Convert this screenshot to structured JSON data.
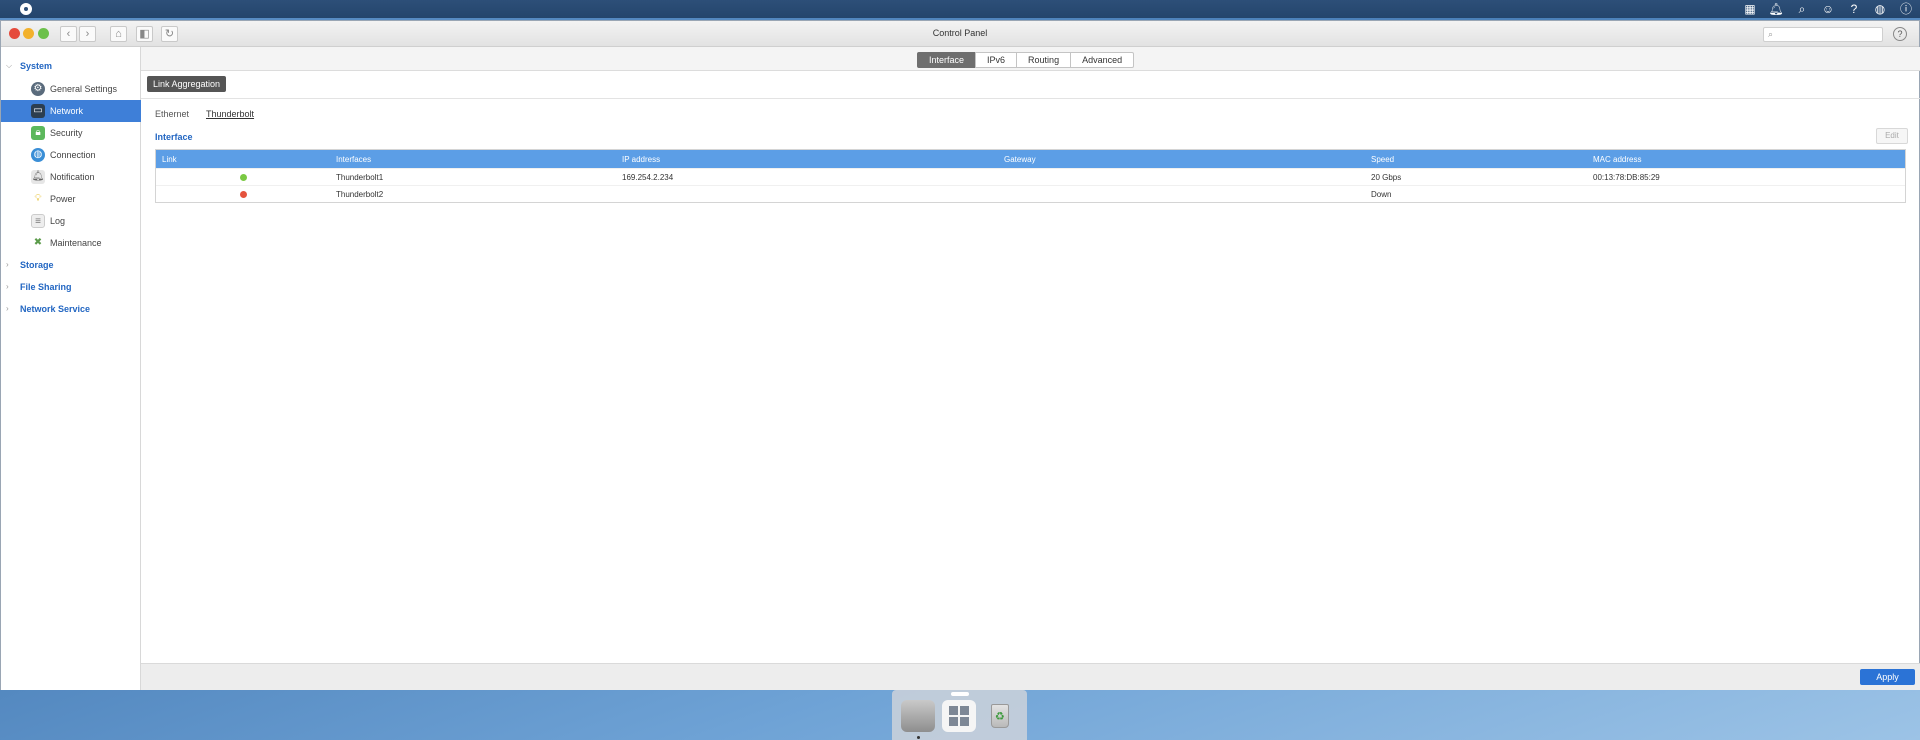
{
  "window": {
    "title": "Control Panel"
  },
  "top_icons": [
    "apps-icon",
    "bell-icon",
    "search-icon",
    "user-icon",
    "help-icon",
    "globe-icon",
    "info-icon"
  ],
  "sidebar": {
    "groups": [
      {
        "label": "System",
        "expanded": true
      },
      {
        "label": "Storage",
        "expanded": false
      },
      {
        "label": "File Sharing",
        "expanded": false
      },
      {
        "label": "Network Service",
        "expanded": false
      }
    ],
    "items": [
      {
        "label": "General Settings",
        "icon": "gear-icon"
      },
      {
        "label": "Network",
        "icon": "network-icon",
        "active": true
      },
      {
        "label": "Security",
        "icon": "lock-icon"
      },
      {
        "label": "Connection",
        "icon": "globe-icon"
      },
      {
        "label": "Notification",
        "icon": "bell-icon"
      },
      {
        "label": "Power",
        "icon": "lightbulb-icon"
      },
      {
        "label": "Log",
        "icon": "document-icon"
      },
      {
        "label": "Maintenance",
        "icon": "tools-icon"
      }
    ]
  },
  "tabs": [
    {
      "label": "Interface",
      "active": true
    },
    {
      "label": "IPv6"
    },
    {
      "label": "Routing"
    },
    {
      "label": "Advanced"
    }
  ],
  "link_aggregation_label": "Link Aggregation",
  "subtabs": [
    {
      "label": "Ethernet"
    },
    {
      "label": "Thunderbolt",
      "active": true
    }
  ],
  "section": {
    "title": "Interface",
    "edit_label": "Edit"
  },
  "table": {
    "columns": [
      "Link",
      "Interfaces",
      "IP address",
      "Gateway",
      "Speed",
      "MAC address"
    ],
    "rows": [
      {
        "link_status": "up",
        "link_color": "#7ac943",
        "interface": "Thunderbolt1",
        "ip": "169.254.2.234",
        "gateway": "",
        "speed": "20 Gbps",
        "mac": "00:13:78:DB:85:29"
      },
      {
        "link_status": "down",
        "link_color": "#e5533d",
        "interface": "Thunderbolt2",
        "ip": "",
        "gateway": "",
        "speed": "Down",
        "mac": ""
      }
    ]
  },
  "footer": {
    "apply_label": "Apply"
  },
  "colors": {
    "accent": "#3e7fd8",
    "header": "#5c9ee6",
    "apply": "#2b73d6"
  }
}
